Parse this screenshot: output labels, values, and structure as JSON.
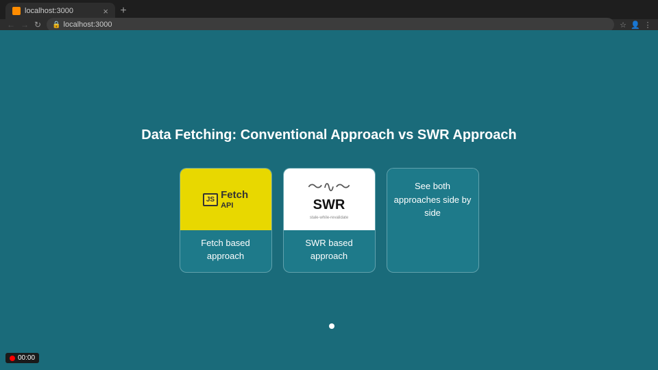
{
  "browser": {
    "tab_favicon": "🔶",
    "tab_label": "localhost:3000",
    "tab_close": "×",
    "tab_new": "+",
    "back_btn": "←",
    "forward_btn": "→",
    "refresh_btn": "↻",
    "address": "localhost:3000",
    "toolbar_icons": [
      "⊡",
      "★",
      "👤",
      "☰"
    ]
  },
  "page": {
    "title": "Data Fetching: Conventional Approach vs SWR Approach",
    "cards": [
      {
        "id": "fetch",
        "type": "fetch",
        "js_badge": "JS",
        "logo_text": "Fetch API",
        "label": "Fetch based approach"
      },
      {
        "id": "swr",
        "type": "swr",
        "swr_title": "SWR",
        "swr_subtitle": "stale-while-revalidate",
        "label": "SWR based approach"
      },
      {
        "id": "both",
        "type": "both",
        "label": "See both approaches side by side"
      }
    ]
  },
  "recording": {
    "time": "00:00"
  }
}
